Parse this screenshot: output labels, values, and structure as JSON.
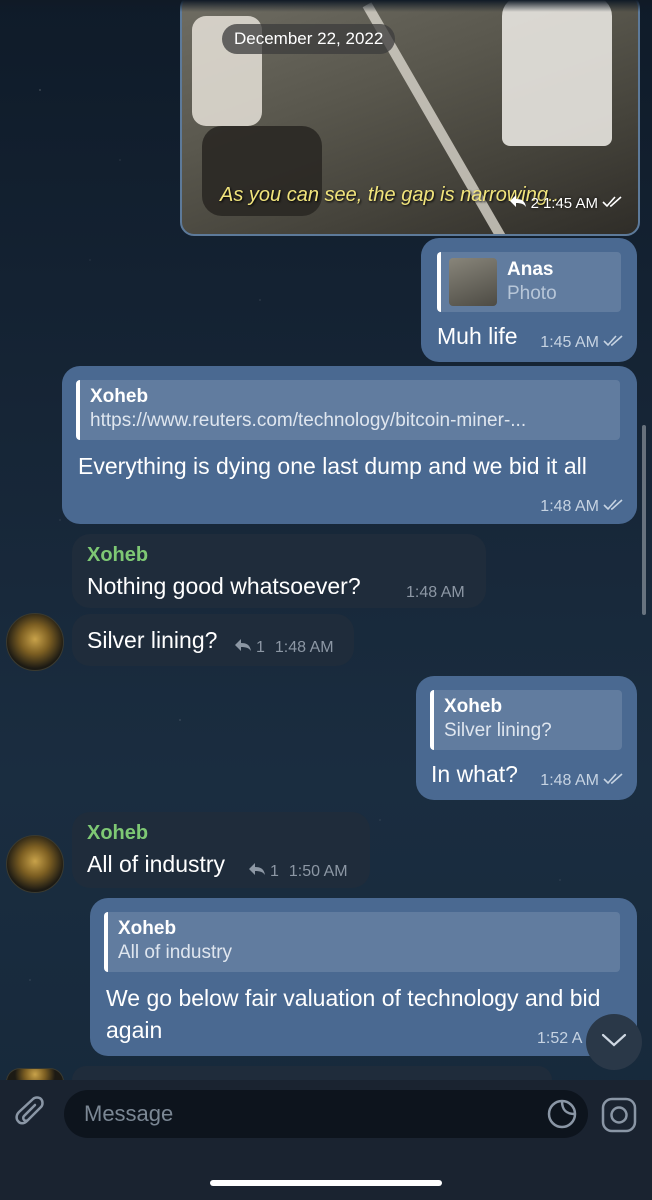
{
  "date_pill": "December 22, 2022",
  "photo_message": {
    "caption": "As you can see, the gap is narrowing...",
    "reply_count": "2",
    "time": "1:45 AM"
  },
  "messages": [
    {
      "direction": "out",
      "reply": {
        "name": "Anas",
        "text": "Photo"
      },
      "text": "Muh life",
      "time": "1:45 AM"
    },
    {
      "direction": "out",
      "reply": {
        "name": "Xoheb",
        "text": "https://www.reuters.com/technology/bitcoin-miner-..."
      },
      "text": "Everything is dying one last dump and we bid it all",
      "time": "1:48 AM"
    },
    {
      "direction": "in",
      "sender": "Xoheb",
      "text": "Nothing good whatsoever?",
      "time": "1:48 AM"
    },
    {
      "direction": "in",
      "text": "Silver lining?",
      "reply_count": "1",
      "time": "1:48 AM"
    },
    {
      "direction": "out",
      "reply": {
        "name": "Xoheb",
        "text": "Silver lining?"
      },
      "text": "In what?",
      "time": "1:48 AM"
    },
    {
      "direction": "in",
      "sender": "Xoheb",
      "text": "All of industry",
      "reply_count": "1",
      "time": "1:50 AM"
    },
    {
      "direction": "out",
      "reply": {
        "name": "Xoheb",
        "text": "All of industry"
      },
      "text": "We go below fair valuation of technology and bid again",
      "time": "1:52 A"
    }
  ],
  "composer": {
    "placeholder": "Message"
  },
  "colors": {
    "outgoing_bubble": "#4a6991",
    "incoming_bubble": "#1f2c3b",
    "sender_name": "#7ec874"
  }
}
